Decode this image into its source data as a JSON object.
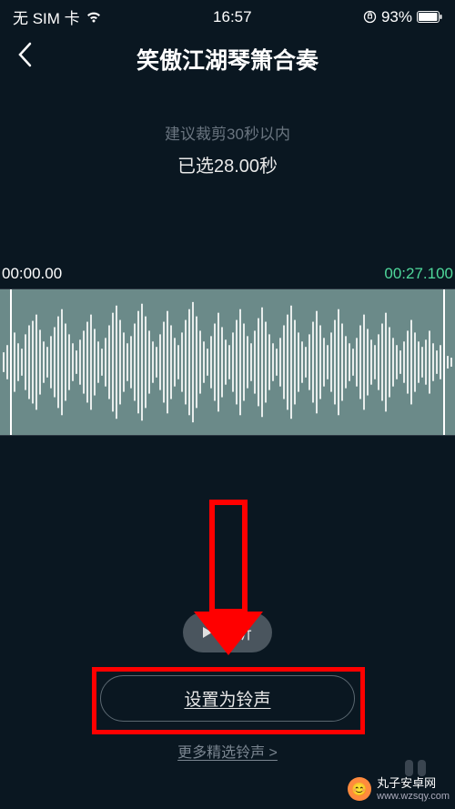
{
  "status_bar": {
    "sim": "无 SIM 卡",
    "time": "16:57",
    "battery_pct": "93%"
  },
  "header": {
    "title": "笑傲江湖琴箫合奏"
  },
  "trim": {
    "hint": "建议裁剪30秒以内",
    "selected_label": "已选28.00秒",
    "start_time": "00:00.00",
    "end_time": "00:27.100"
  },
  "actions": {
    "preview_label": "试听",
    "set_ringtone_label": "设置为铃声",
    "more_label": "更多精选铃声 >"
  },
  "watermark": {
    "brand": "丸子安卓网",
    "url": "www.wzsqy.com"
  }
}
